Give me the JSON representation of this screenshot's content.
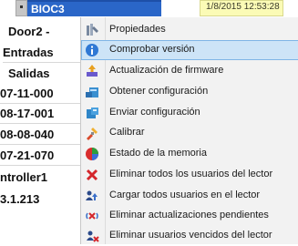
{
  "topbar": {
    "device_name": "BIOC3",
    "datetime": "1/8/2015 12:53:28"
  },
  "left_column": {
    "cells": [
      "Door2 -",
      "Entradas",
      "Salidas",
      "07-11-000",
      "08-17-001",
      "08-08-040",
      "07-21-070",
      "ntroller1",
      "3.1.213"
    ]
  },
  "context_menu": {
    "items": [
      {
        "label": "Propiedades",
        "icon": "properties-icon"
      },
      {
        "label": "Comprobar versión",
        "icon": "info-icon"
      },
      {
        "label": "Actualización de firmware",
        "icon": "firmware-update-icon"
      },
      {
        "label": "Obtener configuración",
        "icon": "get-config-icon"
      },
      {
        "label": "Enviar configuración",
        "icon": "send-config-icon"
      },
      {
        "label": "Calibrar",
        "icon": "calibrate-icon"
      },
      {
        "label": "Estado de la memoria",
        "icon": "memory-status-icon"
      },
      {
        "label": "Eliminar todos los usuarios del lector",
        "icon": "delete-users-icon"
      },
      {
        "label": "Cargar todos usuarios en el lector",
        "icon": "upload-users-icon"
      },
      {
        "label": "Eliminar actualizaciones pendientes",
        "icon": "delete-pending-icon"
      },
      {
        "label": "Eliminar usuarios vencidos del lector",
        "icon": "delete-expired-users-icon"
      }
    ]
  },
  "colors": {
    "highlight": "#cde4f7",
    "header_blue": "#2a66c8",
    "datetime_bg": "#fbfbb6"
  }
}
